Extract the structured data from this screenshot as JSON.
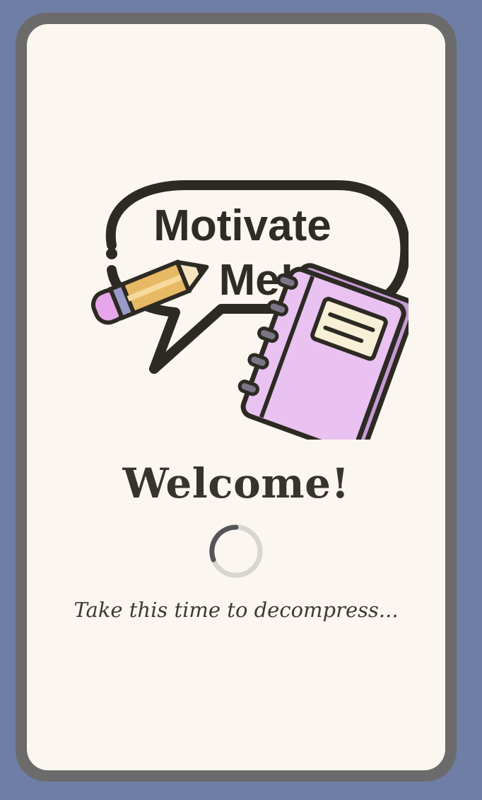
{
  "app": {
    "logo_line1": "Motivate",
    "logo_line2": "Me!"
  },
  "main": {
    "welcome_title": "Welcome!",
    "tagline": "Take this time to decompress..."
  },
  "icons": {
    "logo": "speech-bubble-pencil-notebook-logo",
    "spinner": "loading-spinner"
  },
  "colors": {
    "background": "#6f7ea5",
    "frame": "#6b6b6b",
    "screen": "#fbf6ef",
    "ink": "#36342c",
    "notebook": "#e9c2f1",
    "pencil": "#e8b965",
    "spinner_track": "#d8d6d1",
    "spinner_arc": "#555555"
  }
}
